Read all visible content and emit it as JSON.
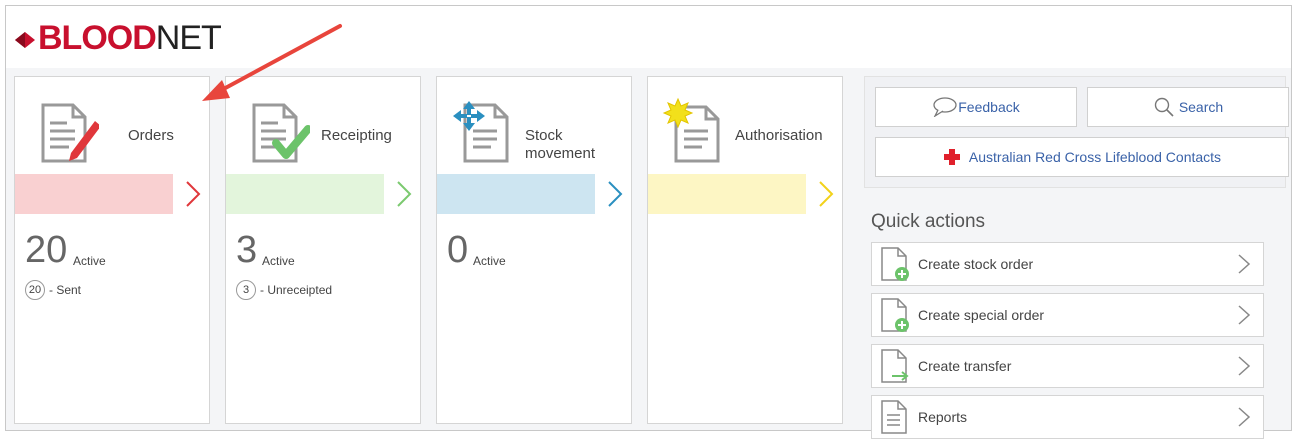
{
  "header": {
    "brand_bold": "BLOOD",
    "brand_light": "NET"
  },
  "tiles": [
    {
      "title": "Orders",
      "count": "20",
      "count_label": "Active",
      "badge": "20",
      "sub_label": "- Sent",
      "bar_color": "#f9d0d1",
      "chev_color": "#e0373b"
    },
    {
      "title": "Receipting",
      "count": "3",
      "count_label": "Active",
      "badge": "3",
      "sub_label": "- Unreceipted",
      "bar_color": "#e3f5dc",
      "chev_color": "#7bc96f"
    },
    {
      "title_line1": "Stock",
      "title_line2": "movement",
      "count": "0",
      "count_label": "Active",
      "bar_color": "#cde5f1",
      "chev_color": "#2a8fc0"
    },
    {
      "title": "Authorisation",
      "bar_color": "#fdf6c4",
      "chev_color": "#f2d21b"
    }
  ],
  "right": {
    "feedback_label": "Feedback",
    "search_label": "Search",
    "contacts_label": "Australian Red Cross Lifeblood Contacts"
  },
  "quick_actions": {
    "title": "Quick actions",
    "items": [
      {
        "label": "Create stock order",
        "icon": "doc-plus-icon"
      },
      {
        "label": "Create special order",
        "icon": "doc-plus-icon"
      },
      {
        "label": "Create transfer",
        "icon": "doc-arrow-icon"
      },
      {
        "label": "Reports",
        "icon": "doc-lines-icon"
      }
    ]
  },
  "colors": {
    "accent_red": "#c8102e",
    "link_blue": "#3a62a8",
    "annotation_arrow": "#e8453c"
  }
}
